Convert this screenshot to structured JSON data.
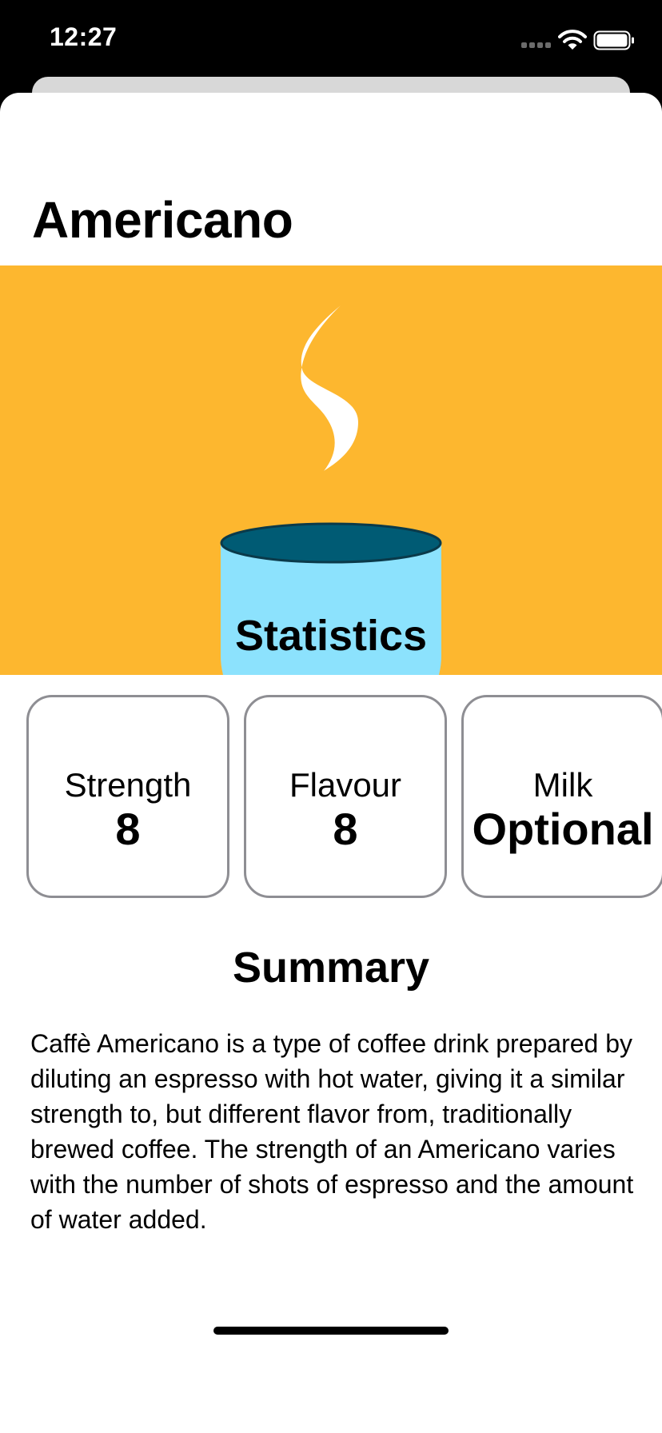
{
  "status_bar": {
    "time": "12:27",
    "icons": [
      "signal-icon",
      "wifi-icon",
      "battery-icon"
    ]
  },
  "detail": {
    "title": "Americano",
    "hero": {
      "icon": "coffee-cup-steam-icon",
      "background_color": "#FDB72F",
      "cup_color": "#8CE2FD",
      "coffee_color": "#005B74",
      "steam_color": "#FFFFFF"
    },
    "statistics": {
      "heading": "Statistics",
      "cards": [
        {
          "label": "Strength",
          "value": "8"
        },
        {
          "label": "Flavour",
          "value": "8"
        },
        {
          "label": "Milk",
          "value": "Optional"
        }
      ]
    },
    "summary": {
      "heading": "Summary",
      "text": "Caffè Americano is a type of coffee drink prepared by diluting an espresso with hot water, giving it a similar strength to, but different flavor from, traditionally brewed coffee. The strength of an Americano varies with the number of shots of espresso and the amount of water added."
    }
  },
  "colors": {
    "card_border": "#8E8E93",
    "sheet_background": "#FFFFFF",
    "status_background": "#000000"
  }
}
